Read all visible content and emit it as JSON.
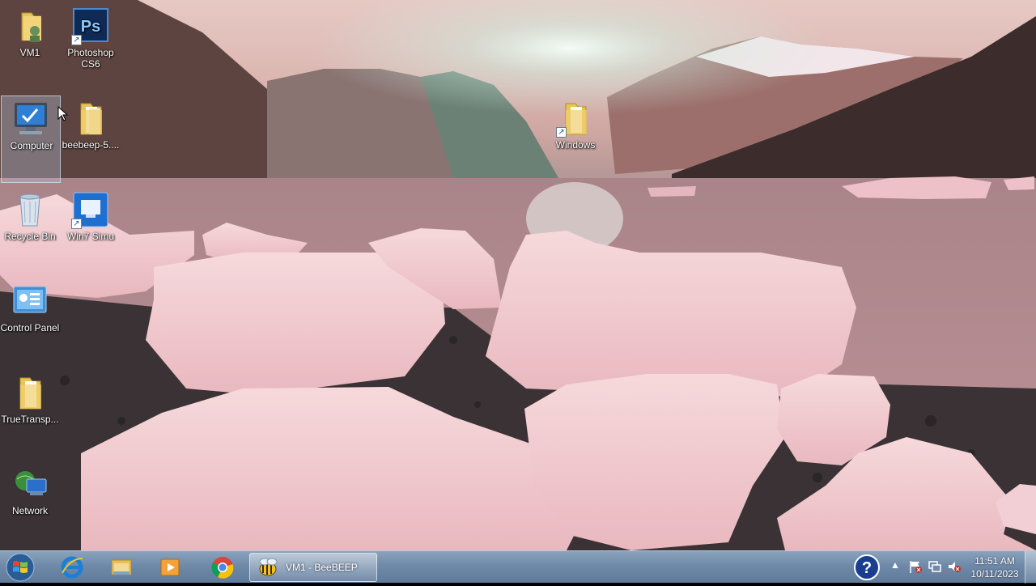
{
  "desktop": {
    "icons": [
      {
        "label": "VM1",
        "icon": "user-folder-icon"
      },
      {
        "label": "Photoshop CS6",
        "icon": "photoshop-icon"
      },
      {
        "label": "Computer",
        "icon": "computer-icon",
        "selected": true
      },
      {
        "label": "beebeep-5....",
        "icon": "folder-icon"
      },
      {
        "label": "Windows",
        "icon": "folder-shortcut-icon"
      },
      {
        "label": "Recycle Bin",
        "icon": "recycle-bin-icon"
      },
      {
        "label": "Win7 Simu",
        "icon": "win7-simu-icon"
      },
      {
        "label": "Control Panel",
        "icon": "control-panel-icon"
      },
      {
        "label": "TrueTransp...",
        "icon": "folder-icon"
      },
      {
        "label": "Network",
        "icon": "network-icon"
      }
    ]
  },
  "taskbar": {
    "start": {
      "icon": "windows-start-icon"
    },
    "pinned": [
      {
        "icon": "internet-explorer-icon"
      },
      {
        "icon": "file-explorer-icon"
      },
      {
        "icon": "media-player-icon"
      },
      {
        "icon": "chrome-icon"
      }
    ],
    "open_window": {
      "label": "VM1 - BeeBEEP",
      "icon": "beebeep-icon"
    },
    "tray": {
      "help_icon": "help-icon",
      "icons": [
        "show-hidden-icons",
        "action-center-flag-icon",
        "network-tray-icon",
        "volume-muted-icon"
      ]
    },
    "clock": {
      "time": "11:51 AM",
      "date": "10/11/2023"
    }
  },
  "colors": {
    "taskbar": "#6f8aa8",
    "selection": "#b4c8e1"
  }
}
